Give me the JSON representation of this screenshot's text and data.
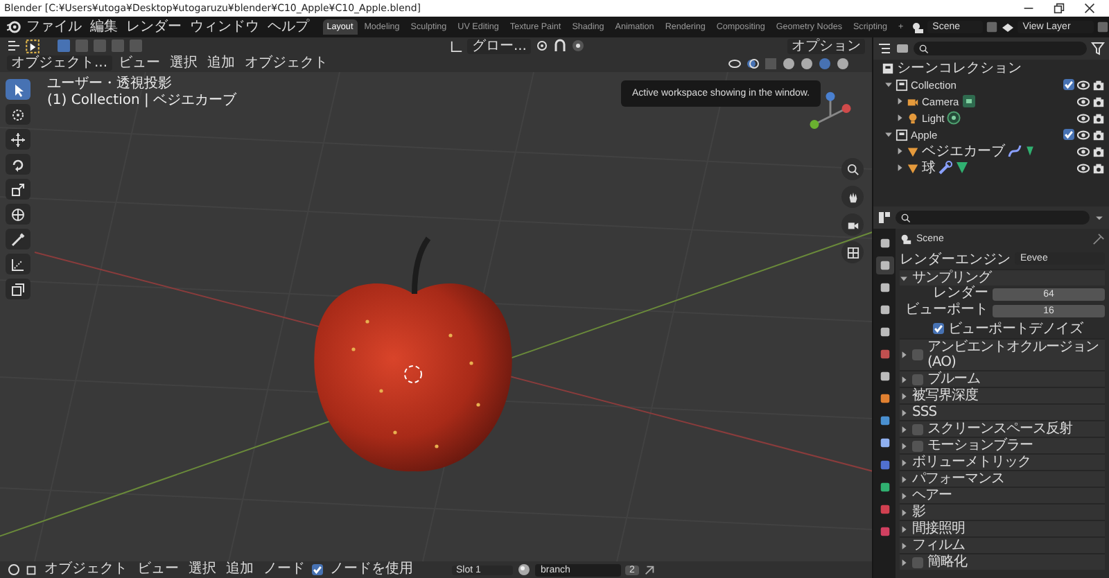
{
  "window": {
    "title": "Blender [C:¥Users¥utoga¥Desktop¥utogaruzu¥blender¥C10_Apple¥C10_Apple.blend]"
  },
  "menu": [
    "ファイル",
    "編集",
    "レンダー",
    "ウィンドウ",
    "ヘルプ"
  ],
  "workspaces": [
    {
      "label": "Layout",
      "selected": true
    },
    {
      "label": "Modeling",
      "selected": false
    },
    {
      "label": "Sculpting",
      "selected": false
    },
    {
      "label": "UV Editing",
      "selected": false
    },
    {
      "label": "Texture Paint",
      "selected": false
    },
    {
      "label": "Shading",
      "selected": false
    },
    {
      "label": "Animation",
      "selected": false
    },
    {
      "label": "Rendering",
      "selected": false
    },
    {
      "label": "Compositing",
      "selected": false
    },
    {
      "label": "Geometry Nodes",
      "selected": false
    },
    {
      "label": "Scripting",
      "selected": false
    }
  ],
  "add_workspace": "+",
  "scene": "Scene",
  "view_layer": "View Layer",
  "viewport": {
    "orientation": "グロー...",
    "mode": "オブジェクト...",
    "menus": [
      "ビュー",
      "選択",
      "追加",
      "オブジェクト"
    ],
    "options": "オプション",
    "tooltip": "Active workspace showing in the window.",
    "view_name": "ユーザー・透視投影",
    "active": "(1) Collection | ベジエカーブ",
    "tools": [
      {
        "selected": true
      },
      {
        "selected": false
      },
      {
        "selected": false
      },
      {
        "selected": false
      },
      {
        "selected": false
      },
      {
        "selected": false
      },
      {
        "selected": false
      },
      {
        "selected": false
      },
      {
        "selected": false
      }
    ]
  },
  "outliner": {
    "root": "シーンコレクション",
    "items": [
      {
        "label": "Collection",
        "kind": "collection",
        "expanded": true,
        "checked": true,
        "children": [
          {
            "label": "Camera",
            "kind": "camera",
            "expanded": false
          },
          {
            "label": "Light",
            "kind": "light",
            "expanded": false
          }
        ]
      },
      {
        "label": "Apple",
        "kind": "collection",
        "expanded": true,
        "checked": true,
        "children": [
          {
            "label": "ベジエカーブ",
            "kind": "curve",
            "expanded": false
          },
          {
            "label": "球",
            "kind": "mesh",
            "expanded": false
          }
        ]
      }
    ]
  },
  "properties": {
    "tabs": [
      {
        "selected": false
      },
      {
        "selected": true
      },
      {
        "selected": false
      },
      {
        "selected": false
      },
      {
        "selected": false
      },
      {
        "selected": false
      },
      {
        "selected": false
      },
      {
        "selected": false
      },
      {
        "selected": false
      },
      {
        "selected": false
      },
      {
        "selected": false
      },
      {
        "selected": false
      },
      {
        "selected": false
      },
      {
        "selected": false
      }
    ],
    "context": "Scene",
    "engine_label": "レンダーエンジン",
    "engine": "Eevee",
    "panels": [
      {
        "label": "サンプリング",
        "kind": "plain",
        "expanded": true,
        "fields": [
          {
            "label": "レンダー",
            "value": "64"
          },
          {
            "label": "ビューポート",
            "value": "16"
          }
        ],
        "option": {
          "label": "ビューポートデノイズ",
          "checked": true
        }
      },
      {
        "label": "アンビエントオクルージョン(AO)",
        "kind": "checkbox",
        "checked": false,
        "expanded": false
      },
      {
        "label": "ブルーム",
        "kind": "checkbox",
        "checked": false,
        "expanded": false
      },
      {
        "label": "被写界深度",
        "kind": "plain",
        "expanded": false
      },
      {
        "label": "SSS",
        "kind": "plain",
        "expanded": false
      },
      {
        "label": "スクリーンスペース反射",
        "kind": "checkbox",
        "checked": false,
        "expanded": false
      },
      {
        "label": "モーションブラー",
        "kind": "checkbox",
        "checked": false,
        "expanded": false
      },
      {
        "label": "ボリューメトリック",
        "kind": "plain",
        "expanded": false
      },
      {
        "label": "パフォーマンス",
        "kind": "plain",
        "expanded": false
      },
      {
        "label": "ヘアー",
        "kind": "plain",
        "expanded": false
      },
      {
        "label": "影",
        "kind": "plain",
        "expanded": false
      },
      {
        "label": "間接照明",
        "kind": "plain",
        "expanded": false
      },
      {
        "label": "フィルム",
        "kind": "plain",
        "expanded": false
      },
      {
        "label": "簡略化",
        "kind": "checkbox",
        "checked": false,
        "expanded": false
      }
    ]
  },
  "node_bar": {
    "mode": "オブジェクト",
    "menus": [
      "ビュー",
      "選択",
      "追加",
      "ノード"
    ],
    "use_nodes": {
      "label": "ノードを使用",
      "checked": true
    },
    "slot": "Slot 1",
    "material": "branch",
    "users": "2"
  }
}
